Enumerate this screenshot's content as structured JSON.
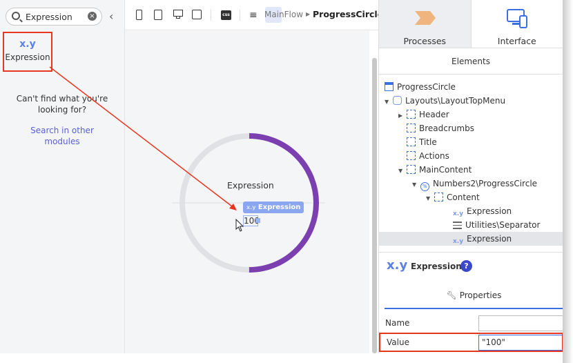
{
  "left_panel": {
    "search_value": "Expression",
    "widget": {
      "icon": "x.y",
      "label": "Expression"
    },
    "not_found": "Can't find what you're looking for?",
    "search_other": "Search in other modules"
  },
  "toolbar": {
    "css": "css",
    "breadcrumb_parent": "MainFlow",
    "breadcrumb_current": "ProgressCircle"
  },
  "canvas": {
    "title": "Expression",
    "badge_icon": "x.y",
    "badge_label": "Expression",
    "value": "100",
    "progress_percent": 50,
    "accent": "#7b3fb0",
    "track": "#e0e1e5"
  },
  "right_panel": {
    "tabs": [
      {
        "label": "Processes"
      },
      {
        "label": "Interface"
      }
    ],
    "section": "Elements",
    "tree": [
      "ProgressCircle",
      "Layouts\\LayoutTopMenu",
      "Header",
      "Breadcrumbs",
      "Title",
      "Actions",
      "MainContent",
      "Numbers2\\ProgressCircle",
      "Content",
      "Expression",
      "Utilities\\Separator",
      "Expression"
    ],
    "selected": {
      "icon": "x.y",
      "name": "Expression",
      "help": "?"
    },
    "properties_tab": "Properties",
    "props": [
      {
        "label": "Name",
        "value": ""
      },
      {
        "label": "Value",
        "value": "\"100\""
      }
    ]
  }
}
